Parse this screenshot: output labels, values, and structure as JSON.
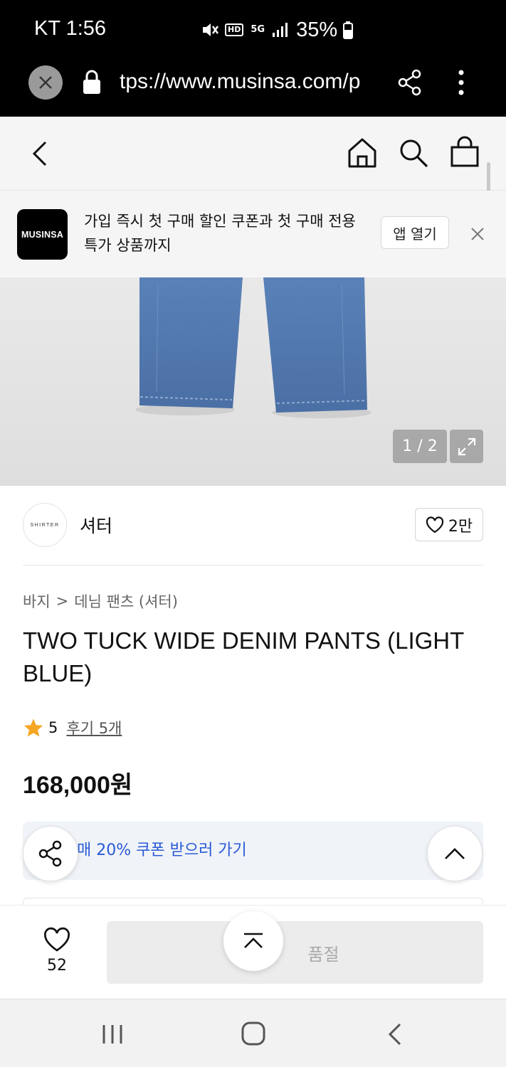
{
  "status_bar": {
    "carrier_time": "KT 1:56",
    "network": "5G",
    "hd": "HD",
    "battery": "35%"
  },
  "browser": {
    "url": "tps://www.musinsa.com/p"
  },
  "app_banner": {
    "logo_text": "MUSINSA",
    "message": "가입 즉시 첫 구매 할인 쿠폰과 첫 구매 전용 특가 상품까지",
    "open_app_label": "앱 열기"
  },
  "gallery": {
    "counter": "1 / 2"
  },
  "brand": {
    "logo_text": "SHIRTER",
    "name": "셔터",
    "likes": "2만"
  },
  "product": {
    "breadcrumb": [
      "바지",
      "데님 팬츠 (셔터)"
    ],
    "breadcrumb_separator": ">",
    "title": "TWO TUCK WIDE DENIM PANTS (LIGHT BLUE)",
    "rating": "5",
    "reviews": "후기 5개",
    "price": "168,000원",
    "coupon_text": "매 20% 쿠폰 받으러 가기"
  },
  "purchase_bar": {
    "wish_count": "52",
    "soldout_label": "품절"
  },
  "colors": {
    "accent_blue": "#2a5ad6",
    "star": "#f5a623",
    "denim": "#4f77ad"
  }
}
